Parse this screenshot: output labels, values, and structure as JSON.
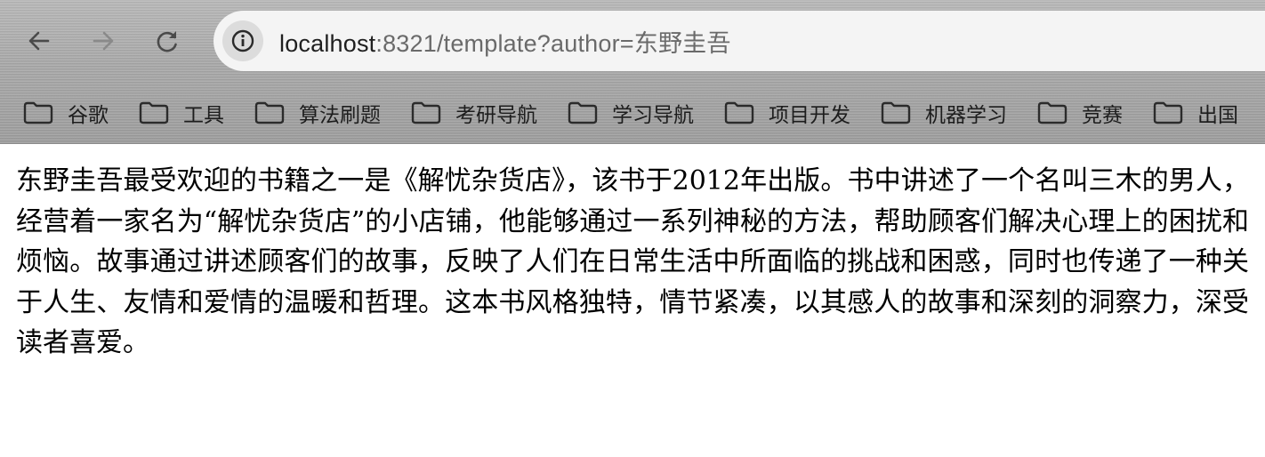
{
  "browser": {
    "url_host": "localhost",
    "url_rest": ":8321/template?author=东野圭吾",
    "nav_icons": [
      "back-arrow-icon",
      "forward-arrow-icon",
      "reload-icon",
      "info-icon"
    ]
  },
  "bookmarks": {
    "icon": "folder-icon",
    "items": [
      {
        "label": "谷歌"
      },
      {
        "label": "工具"
      },
      {
        "label": "算法刷题"
      },
      {
        "label": "考研导航"
      },
      {
        "label": "学习导航"
      },
      {
        "label": "项目开发"
      },
      {
        "label": "机器学习"
      },
      {
        "label": "竞赛"
      },
      {
        "label": "出国"
      }
    ]
  },
  "page": {
    "paragraph": "东野圭吾最受欢迎的书籍之一是《解忧杂货店》，该书于2012年出版。书中讲述了一个名叫三木的男人，经营着一家名为“解忧杂货店”的小店铺，他能够通过一系列神秘的方法，帮助顾客们解决心理上的困扰和烦恼。故事通过讲述顾客们的故事，反映了人们在日常生活中所面临的挑战和困惑，同时也传递了一种关于人生、友情和爱情的温暖和哲理。这本书风格独特，情节紧凑，以其感人的故事和深刻的洞察力，深受读者喜爱。"
  }
}
